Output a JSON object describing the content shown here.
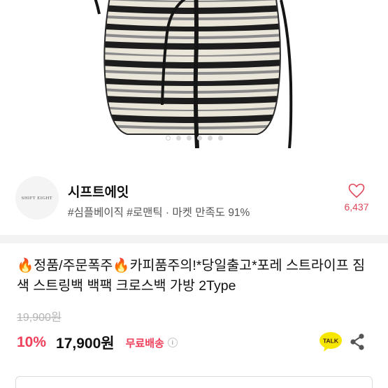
{
  "product_image": {
    "icon": "striped-bucket-bag-photo",
    "pager": {
      "count": 6,
      "active_index": 0
    }
  },
  "shop": {
    "logo_text": "SHIFT EIGHT",
    "name": "시프트에잇",
    "tags": "#심플베이직 #로맨틱 · 마켓 만족도 91%",
    "likes": "6,437",
    "like_icon": "heart-icon"
  },
  "product": {
    "title": "🔥정품/주문폭주🔥카피품주의!*당일출고*포레 스트라이프 짐색 스트링백 백팩 크로스백 가방 2Type",
    "original_price": "19,900원",
    "discount": "10%",
    "sale_price": "17,900원",
    "shipping": "무료배송",
    "info_icon": "info-icon"
  },
  "actions": {
    "talk_label": "TALK",
    "share_icon": "share-icon"
  },
  "colors": {
    "accent": "#ef3f5a",
    "talk_bubble": "#f7e600"
  }
}
